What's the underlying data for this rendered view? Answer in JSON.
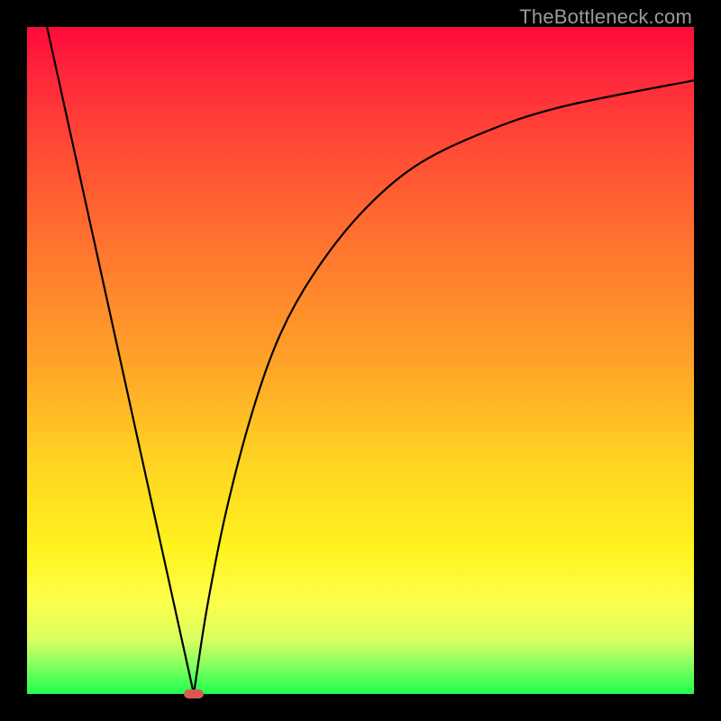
{
  "watermark": "TheBottleneck.com",
  "chart_data": {
    "type": "line",
    "title": "",
    "xlabel": "",
    "ylabel": "",
    "xlim": [
      0,
      100
    ],
    "ylim": [
      0,
      100
    ],
    "grid": false,
    "legend": false,
    "series": [
      {
        "name": "left-branch",
        "x": [
          3,
          25
        ],
        "y": [
          100,
          0
        ]
      },
      {
        "name": "right-branch",
        "x": [
          25,
          27,
          30,
          34,
          38,
          43,
          50,
          58,
          68,
          80,
          100
        ],
        "y": [
          0,
          13,
          28,
          43,
          54,
          63,
          72,
          79,
          84,
          88,
          92
        ]
      }
    ],
    "marker": {
      "x": 25,
      "y": 0,
      "color": "#d65a52"
    },
    "gradient_stops": [
      {
        "pos": 0,
        "color": "#ff0a3a"
      },
      {
        "pos": 8,
        "color": "#ff2a3a"
      },
      {
        "pos": 20,
        "color": "#ff5034"
      },
      {
        "pos": 35,
        "color": "#ff7a2e"
      },
      {
        "pos": 50,
        "color": "#ffa228"
      },
      {
        "pos": 65,
        "color": "#ffd322"
      },
      {
        "pos": 78,
        "color": "#fff21e"
      },
      {
        "pos": 86,
        "color": "#fdff4a"
      },
      {
        "pos": 92,
        "color": "#d8ff60"
      },
      {
        "pos": 96,
        "color": "#7dff60"
      },
      {
        "pos": 100,
        "color": "#1eff4e"
      }
    ]
  }
}
